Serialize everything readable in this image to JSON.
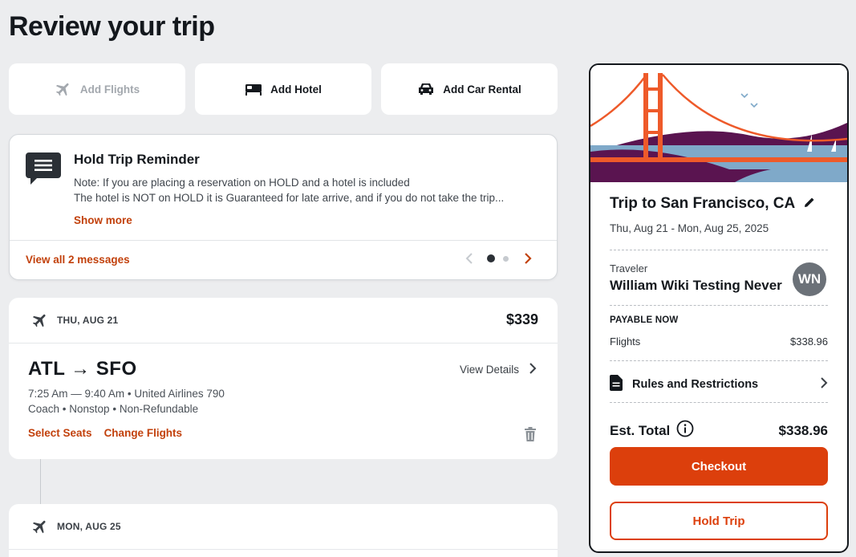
{
  "page": {
    "title": "Review your trip"
  },
  "add_options": {
    "flights": {
      "label": "Add Flights",
      "icon": "plane-icon",
      "disabled": true
    },
    "hotel": {
      "label": "Add Hotel",
      "icon": "bed-icon"
    },
    "car": {
      "label": "Add Car Rental",
      "icon": "car-icon"
    }
  },
  "reminder": {
    "title": "Hold Trip Reminder",
    "line1": "Note: If you are placing a reservation on HOLD and a hotel is included",
    "line2": "The hotel is NOT on HOLD it is Guaranteed for late arrive, and if you do not take the trip...",
    "show_more": "Show more",
    "view_all": "View all 2 messages",
    "page_current": 1,
    "page_total": 2
  },
  "flights": [
    {
      "date": "THU, AUG 21",
      "price": "$339",
      "route": "ATL → SFO",
      "view_details": "View Details",
      "times": "7:25 Am — 9:40 Am",
      "airline": "United Airlines 790",
      "cabin": "Coach",
      "stops": "Nonstop",
      "fare": "Non-Refundable",
      "select_seats": "Select Seats",
      "change_flights": "Change Flights"
    },
    {
      "date": "MON, AUG 25"
    }
  ],
  "summary": {
    "trip_title": "Trip to San Francisco, CA",
    "dates": "Thu, Aug 21 - Mon, Aug 25, 2025",
    "traveler_label": "Traveler",
    "traveler_name": "William Wiki Testing Never",
    "avatar_initials": "WN",
    "payable_now": "PAYABLE NOW",
    "flights_label": "Flights",
    "flights_amount": "$338.96",
    "rules": "Rules and Restrictions",
    "est_total_label": "Est. Total",
    "est_total_amount": "$338.96",
    "checkout": "Checkout",
    "hold": "Hold Trip"
  },
  "colors": {
    "accent": "#dc3f0c",
    "link": "#c2410c",
    "bridge": "#ee5a2a",
    "hills": "#5a1450",
    "water": "#7fa9c9"
  }
}
